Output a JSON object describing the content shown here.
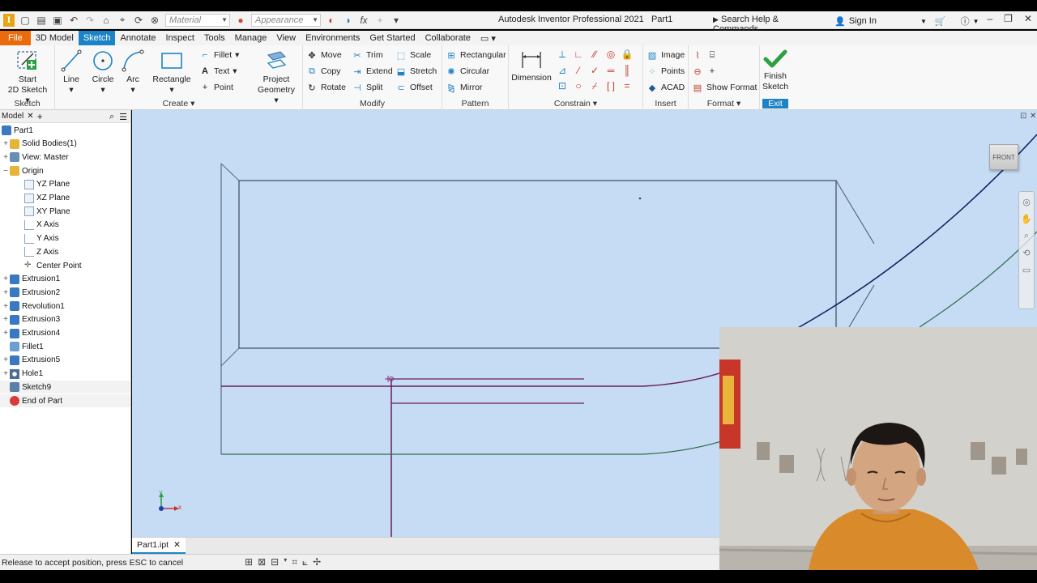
{
  "title_bar": {
    "app_title": "Autodesk Inventor Professional 2021",
    "doc_name": "Part1",
    "material_placeholder": "Material",
    "appearance_placeholder": "Appearance",
    "search_text": "Search Help & Commands...",
    "signin_label": "Sign In"
  },
  "menu_tabs": [
    "File",
    "3D Model",
    "Sketch",
    "Annotate",
    "Inspect",
    "Tools",
    "Manage",
    "View",
    "Environments",
    "Get Started",
    "Collaborate"
  ],
  "active_tab": "Sketch",
  "ribbon": {
    "sketch_panel": {
      "label": "Sketch",
      "start_line1": "Start",
      "start_line2": "2D Sketch"
    },
    "create_panel": {
      "label": "Create",
      "line": "Line",
      "circle": "Circle",
      "arc": "Arc",
      "rectangle": "Rectangle",
      "fillet": "Fillet",
      "text": "Text",
      "point": "Point",
      "project_line1": "Project",
      "project_line2": "Geometry"
    },
    "modify_panel": {
      "label": "Modify",
      "move": "Move",
      "trim": "Trim",
      "scale": "Scale",
      "copy": "Copy",
      "extend": "Extend",
      "stretch": "Stretch",
      "rotate": "Rotate",
      "split": "Split",
      "offset": "Offset"
    },
    "pattern_panel": {
      "label": "Pattern",
      "rectangular": "Rectangular",
      "circular": "Circular",
      "mirror": "Mirror"
    },
    "constrain_panel": {
      "label": "Constrain",
      "dimension": "Dimension"
    },
    "insert_panel": {
      "label": "Insert",
      "image": "Image",
      "points": "Points",
      "acad": "ACAD"
    },
    "format_panel": {
      "label": "Format",
      "show_format": "Show Format"
    },
    "exit_panel": {
      "label": "Exit",
      "finish_line1": "Finish",
      "finish_line2": "Sketch"
    }
  },
  "browser": {
    "tab_label": "Model",
    "tree": [
      {
        "label": "Part1",
        "level": 0,
        "exp": "",
        "icon": "part"
      },
      {
        "label": "Solid Bodies(1)",
        "level": 1,
        "exp": "+",
        "icon": "folder"
      },
      {
        "label": "View: Master",
        "level": 1,
        "exp": "+",
        "icon": "view"
      },
      {
        "label": "Origin",
        "level": 1,
        "exp": "−",
        "icon": "folder"
      },
      {
        "label": "YZ Plane",
        "level": 2,
        "exp": "",
        "icon": "plane"
      },
      {
        "label": "XZ Plane",
        "level": 2,
        "exp": "",
        "icon": "plane"
      },
      {
        "label": "XY Plane",
        "level": 2,
        "exp": "",
        "icon": "plane"
      },
      {
        "label": "X Axis",
        "level": 2,
        "exp": "",
        "icon": "axis"
      },
      {
        "label": "Y Axis",
        "level": 2,
        "exp": "",
        "icon": "axis"
      },
      {
        "label": "Z Axis",
        "level": 2,
        "exp": "",
        "icon": "axis"
      },
      {
        "label": "Center Point",
        "level": 2,
        "exp": "",
        "icon": "point"
      },
      {
        "label": "Extrusion1",
        "level": 1,
        "exp": "+",
        "icon": "feature"
      },
      {
        "label": "Extrusion2",
        "level": 1,
        "exp": "+",
        "icon": "feature"
      },
      {
        "label": "Revolution1",
        "level": 1,
        "exp": "+",
        "icon": "feature"
      },
      {
        "label": "Extrusion3",
        "level": 1,
        "exp": "+",
        "icon": "feature"
      },
      {
        "label": "Extrusion4",
        "level": 1,
        "exp": "+",
        "icon": "feature"
      },
      {
        "label": "Fillet1",
        "level": 1,
        "exp": "",
        "icon": "fillet"
      },
      {
        "label": "Extrusion5",
        "level": 1,
        "exp": "+",
        "icon": "feature"
      },
      {
        "label": "Hole1",
        "level": 1,
        "exp": "+",
        "icon": "hole"
      },
      {
        "label": "Sketch9",
        "level": 1,
        "exp": "",
        "icon": "sketch"
      },
      {
        "label": "End of Part",
        "level": 1,
        "exp": "",
        "icon": "end"
      }
    ]
  },
  "viewcube_label": "FRONT",
  "triad": {
    "x": "x",
    "y": "Y"
  },
  "document_tab": "Part1.ipt",
  "status_text": "Release to accept position, press ESC to cancel",
  "colors": {
    "accent": "#1c84c6",
    "file_tab": "#e96b0c",
    "canvas_bg": "#c6dcf5",
    "sketch_purple": "#6b1b5e",
    "sketch_navy": "#0f1c5c",
    "sketch_green": "#2f6b4a"
  }
}
